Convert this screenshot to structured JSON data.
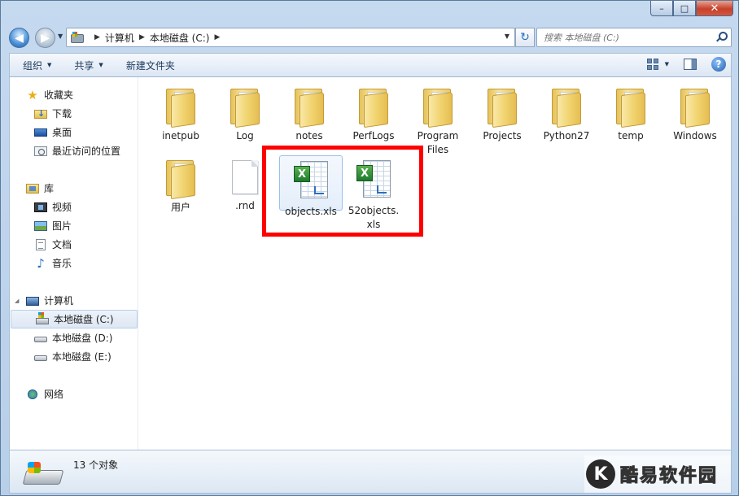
{
  "window": {
    "minimize": "–",
    "maximize": "□",
    "close": "✕"
  },
  "navigation": {
    "back": "◀",
    "forward": "▶",
    "recent_dropdown": "▼"
  },
  "address": {
    "breadcrumb": [
      "计算机",
      "本地磁盘 (C:)"
    ],
    "separator": "▶",
    "dropdown": "▼",
    "refresh": "↻"
  },
  "search": {
    "placeholder": "搜索 本地磁盘 (C:)"
  },
  "toolbar": {
    "organize": "组织",
    "share": "共享",
    "new_folder": "新建文件夹",
    "help": "?"
  },
  "sidebar": {
    "favorites": {
      "title": "收藏夹",
      "items": [
        "下载",
        "桌面",
        "最近访问的位置"
      ]
    },
    "libraries": {
      "title": "库",
      "items": [
        "视频",
        "图片",
        "文档",
        "音乐"
      ]
    },
    "computer": {
      "title": "计算机",
      "items": [
        "本地磁盘 (C:)",
        "本地磁盘 (D:)",
        "本地磁盘 (E:)"
      ],
      "selected": "本地磁盘 (C:)"
    },
    "network": {
      "title": "网络"
    }
  },
  "files": [
    {
      "name": "inetpub",
      "type": "folder"
    },
    {
      "name": "Log",
      "type": "folder"
    },
    {
      "name": "notes",
      "type": "folder"
    },
    {
      "name": "PerfLogs",
      "type": "folder"
    },
    {
      "name": "Program Files",
      "type": "folder"
    },
    {
      "name": "Projects",
      "type": "folder"
    },
    {
      "name": "Python27",
      "type": "folder"
    },
    {
      "name": "temp",
      "type": "folder"
    },
    {
      "name": "Windows",
      "type": "folder"
    },
    {
      "name": "用户",
      "type": "folder"
    },
    {
      "name": ".rnd",
      "type": "file"
    },
    {
      "name": "objects.xls",
      "type": "xls",
      "selected": true
    },
    {
      "name": "52objects.xls",
      "type": "xls"
    }
  ],
  "file_labels": {
    "program_files": "Program\nFiles",
    "52objects": "52objects.\nxls"
  },
  "status": {
    "count": "13 个对象"
  },
  "watermark": {
    "logo": "K",
    "text": "酷易软件园"
  },
  "colors": {
    "highlight_box": "#ff0000",
    "selection": "#99c1ea"
  }
}
